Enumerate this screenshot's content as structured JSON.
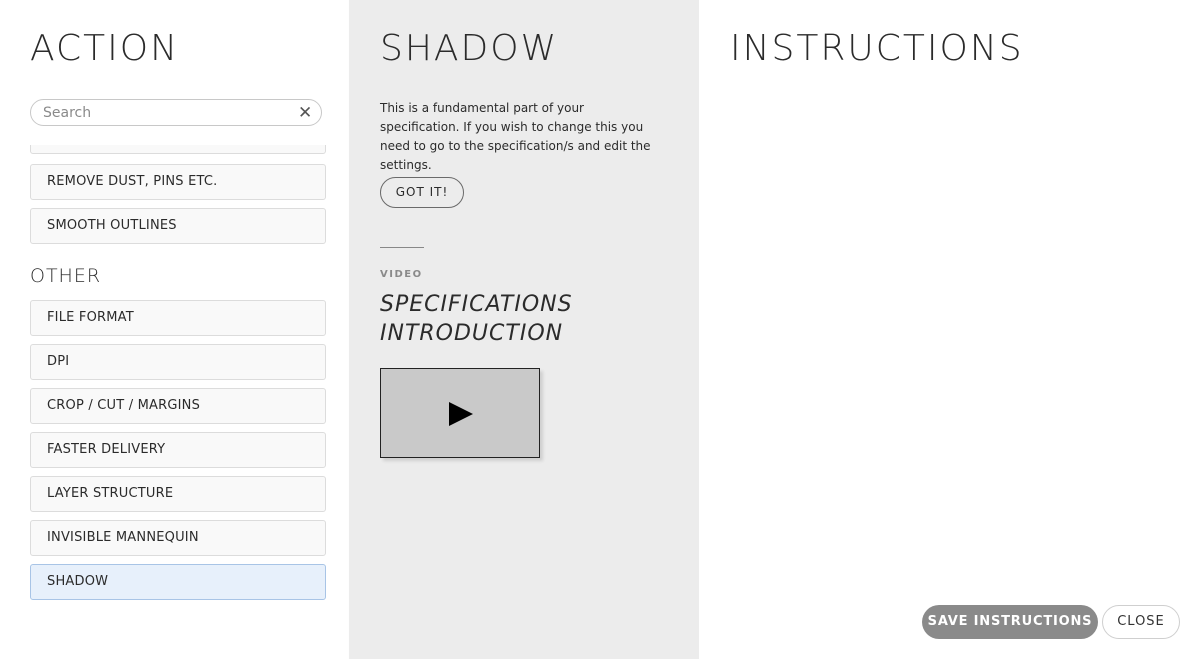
{
  "action": {
    "heading": "ACTION",
    "search": {
      "placeholder": "Search",
      "value": "",
      "clear_icon": "✕"
    },
    "items_top": [
      {
        "label": ""
      },
      {
        "label": "REMOVE DUST, PINS ETC."
      },
      {
        "label": "SMOOTH OUTLINES"
      }
    ],
    "group_other": "OTHER",
    "items_other": [
      {
        "label": "FILE FORMAT"
      },
      {
        "label": "DPI"
      },
      {
        "label": "CROP / CUT / MARGINS"
      },
      {
        "label": "FASTER DELIVERY"
      },
      {
        "label": "LAYER STRUCTURE"
      },
      {
        "label": "INVISIBLE MANNEQUIN"
      },
      {
        "label": "SHADOW",
        "selected": true
      }
    ]
  },
  "shadow": {
    "heading": "SHADOW",
    "description": "This is a fundamental part of your specification. If you wish to change this you need to go to the specification/s and edit the settings.",
    "got_it_label": "GOT IT!",
    "video_label": "VIDEO",
    "video_title": "SPECIFICATIONS INTRODUCTION",
    "video_icon": "play-icon"
  },
  "instructions": {
    "heading": "INSTRUCTIONS"
  },
  "footer": {
    "save_label": "SAVE INSTRUCTIONS",
    "close_label": "CLOSE"
  },
  "colors": {
    "selected_item_bg": "#e7f0fb",
    "selected_item_border": "#a8c4e6",
    "middle_panel_bg": "#ececec",
    "save_button_bg": "#8a8a8a"
  }
}
